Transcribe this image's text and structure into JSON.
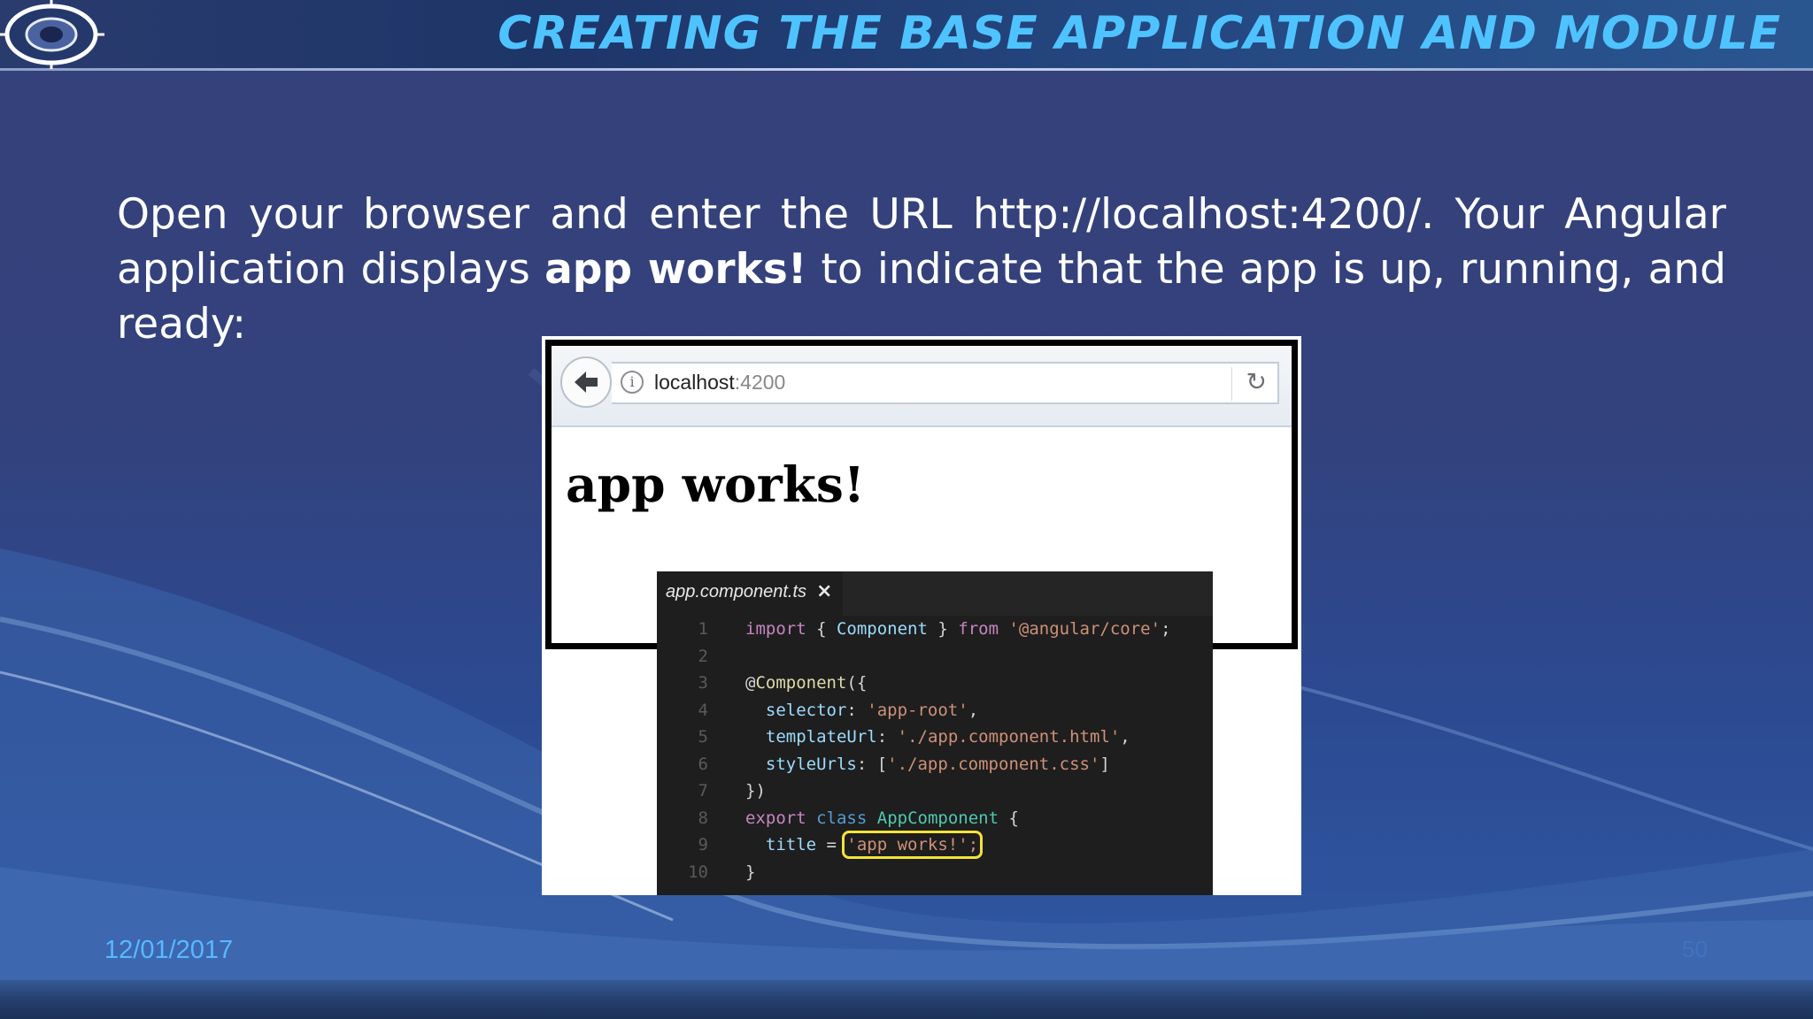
{
  "slide": {
    "title": "CREATING THE BASE APPLICATION AND MODULE",
    "body_prefix": "Open your browser and enter the URL http://localhost:4200/. Your Angular application displays ",
    "body_bold": "app works!",
    "body_suffix": " to indicate that the app is up, running, and ready:",
    "footer_date": "12/01/2017",
    "page_number": "50"
  },
  "browser": {
    "url_host": "localhost",
    "url_port": ":4200",
    "page_heading": "app works!",
    "icons": [
      "back-arrow-icon",
      "info-icon",
      "reload-icon"
    ]
  },
  "editor": {
    "tab_label": "app.component.ts",
    "tab_close": "×",
    "lines": [
      {
        "n": "1",
        "parts": [
          [
            "kw",
            "import"
          ],
          [
            "p",
            " { "
          ],
          [
            "id",
            "Component"
          ],
          [
            "p",
            " } "
          ],
          [
            "kw",
            "from"
          ],
          [
            "p",
            " "
          ],
          [
            "str",
            "'@angular/core'"
          ],
          [
            "p",
            ";"
          ]
        ]
      },
      {
        "n": "2",
        "parts": []
      },
      {
        "n": "3",
        "parts": [
          [
            "p",
            "@"
          ],
          [
            "fn",
            "Component"
          ],
          [
            "p",
            "({"
          ]
        ]
      },
      {
        "n": "4",
        "parts": [
          [
            "p",
            "  "
          ],
          [
            "id",
            "selector"
          ],
          [
            "p",
            ": "
          ],
          [
            "str",
            "'app-root'"
          ],
          [
            "p",
            ","
          ]
        ]
      },
      {
        "n": "5",
        "parts": [
          [
            "p",
            "  "
          ],
          [
            "id",
            "templateUrl"
          ],
          [
            "p",
            ": "
          ],
          [
            "str",
            "'./app.component.html'"
          ],
          [
            "p",
            ","
          ]
        ]
      },
      {
        "n": "6",
        "parts": [
          [
            "p",
            "  "
          ],
          [
            "id",
            "styleUrls"
          ],
          [
            "p",
            ": ["
          ],
          [
            "str",
            "'./app.component.css'"
          ],
          [
            "p",
            "]"
          ]
        ]
      },
      {
        "n": "7",
        "parts": [
          [
            "p",
            "})"
          ]
        ]
      },
      {
        "n": "8",
        "parts": [
          [
            "kw",
            "export"
          ],
          [
            "p",
            " "
          ],
          [
            "st",
            "class"
          ],
          [
            "p",
            " "
          ],
          [
            "cls",
            "AppComponent"
          ],
          [
            "p",
            " {"
          ]
        ]
      },
      {
        "n": "9",
        "parts": [
          [
            "p",
            "  "
          ],
          [
            "id",
            "title"
          ],
          [
            "p",
            " = "
          ],
          [
            "hl",
            "'app works!';"
          ]
        ]
      },
      {
        "n": "10",
        "parts": [
          [
            "p",
            "}"
          ]
        ]
      }
    ]
  },
  "colors": {
    "title": "#4fc3ff",
    "body_text": "#ffffff",
    "footer_date": "#58b9ff",
    "highlight": "#f3e33a"
  }
}
